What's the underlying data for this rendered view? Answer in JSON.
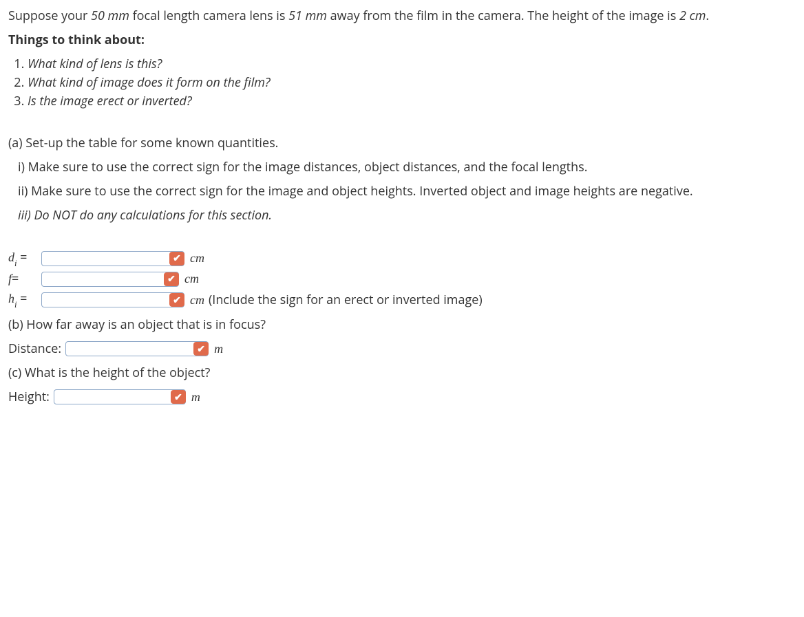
{
  "intro": {
    "pre1": "Suppose your ",
    "focal_val": "50 mm",
    "mid1": " focal length camera lens is ",
    "dist_val": "51 mm",
    "post1": " away from the film in the camera. The height of the image is ",
    "hi_val": "2 cm",
    "end1": "."
  },
  "think_heading": "Things to think about:",
  "think_items": [
    "What kind of lens is this?",
    "What kind of image does it form on the film?",
    "Is the image erect or inverted?"
  ],
  "part_a": {
    "heading": "(a) Set-up the table for some known quantities.",
    "i": "   i) Make sure to use the correct sign for the image distances, object distances, and the focal lengths.",
    "ii": "   ii) Make sure to use the correct sign for the image and object heights. Inverted object and image heights are negative.",
    "iii": "   iii) Do NOT do any calculations for this section."
  },
  "rows": {
    "di": {
      "label_pre": "d",
      "label_sub": "i",
      "eq": " = ",
      "unit": "cm",
      "value": ""
    },
    "f": {
      "label_pre": "f",
      "eq": "= ",
      "unit": "cm",
      "value": ""
    },
    "hi": {
      "label_pre": "h",
      "label_sub": "i",
      "eq": " = ",
      "unit": "cm",
      "note": "(Include the sign for an erect or inverted image)",
      "value": ""
    }
  },
  "part_b": {
    "q": "(b) How far away is an object that is in focus?",
    "label": "Distance:",
    "unit": "m",
    "value": ""
  },
  "part_c": {
    "q": "(c) What is the height of the object?",
    "label": "Height:",
    "unit": "m",
    "value": ""
  },
  "check_glyph": "✔"
}
